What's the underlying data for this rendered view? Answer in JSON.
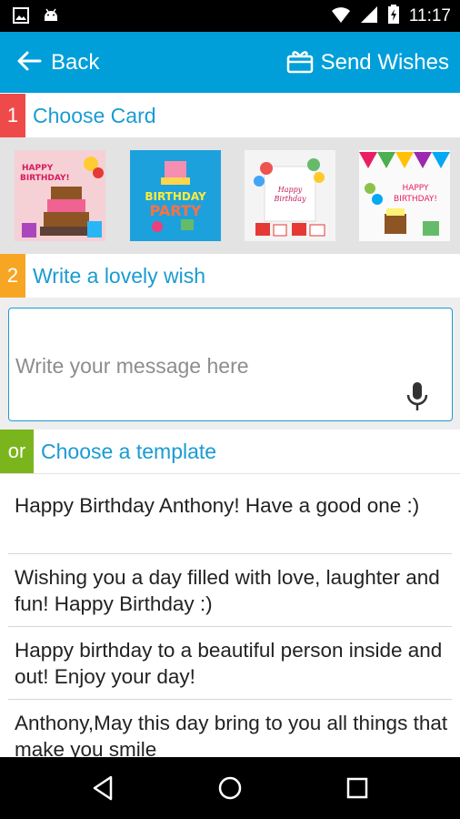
{
  "status_bar": {
    "time": "11:17",
    "icons": [
      "image-icon",
      "android-icon",
      "wifi-icon",
      "signal-icon",
      "battery-charging-icon"
    ]
  },
  "app_bar": {
    "back_label": "Back",
    "send_label": "Send Wishes",
    "back_icon": "arrow-left-icon",
    "send_icon": "gift-icon",
    "color": "#009fd9"
  },
  "steps": {
    "choose_card": {
      "number": "1",
      "title": "Choose Card",
      "color": "#ef4a4a"
    },
    "write_wish": {
      "number": "2",
      "title": "Write a lovely wish",
      "color": "#f7a623"
    },
    "choose_template": {
      "number": "or",
      "title": "Choose a template",
      "color": "#7bb51d"
    }
  },
  "cards": [
    {
      "name": "card-happy-birthday-cake",
      "text": "HAPPY BIRTHDAY!"
    },
    {
      "name": "card-birthday-party",
      "text": "BIRTHDAY PARTY"
    },
    {
      "name": "card-balloons",
      "text": "Happy Birthday"
    },
    {
      "name": "card-bunting",
      "text": "HAPPY BIRTHDAY!"
    }
  ],
  "wish": {
    "placeholder": "Write your message here",
    "mic_icon": "microphone-icon"
  },
  "templates": [
    "Happy Birthday Anthony! Have a good one :)",
    "Wishing you a day filled with love, laughter and fun! Happy Birthday :)",
    "Happy birthday to a beautiful person inside and out! Enjoy your day!",
    "Anthony,May this day bring to you all things that make you smile"
  ],
  "nav_bar": {
    "icons": [
      "back-triangle-icon",
      "home-circle-icon",
      "recents-square-icon"
    ]
  }
}
